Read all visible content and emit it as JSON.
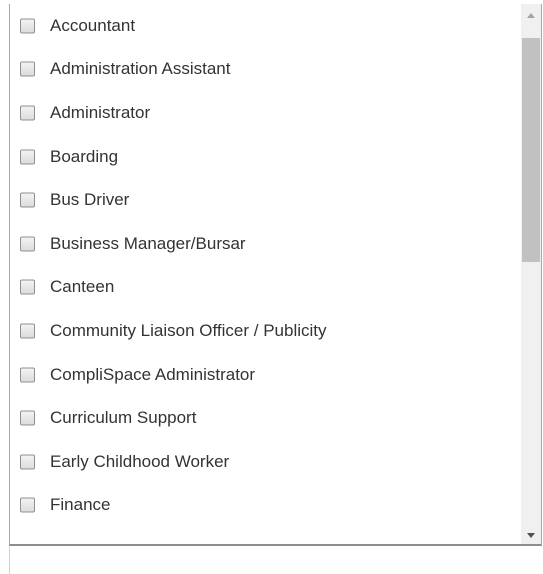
{
  "listbox": {
    "items": [
      {
        "label": "Accountant",
        "checked": false
      },
      {
        "label": "Administration Assistant",
        "checked": false
      },
      {
        "label": "Administrator",
        "checked": false
      },
      {
        "label": "Boarding",
        "checked": false
      },
      {
        "label": "Bus Driver",
        "checked": false
      },
      {
        "label": "Business Manager/Bursar",
        "checked": false
      },
      {
        "label": "Canteen",
        "checked": false
      },
      {
        "label": "Community Liaison Officer / Publicity",
        "checked": false
      },
      {
        "label": "CompliSpace Administrator",
        "checked": false
      },
      {
        "label": "Curriculum Support",
        "checked": false
      },
      {
        "label": "Early Childhood Worker",
        "checked": false
      },
      {
        "label": "Finance",
        "checked": false
      }
    ]
  },
  "scrollbar": {
    "up_icon": "triangle-up-icon",
    "down_icon": "triangle-down-icon"
  }
}
